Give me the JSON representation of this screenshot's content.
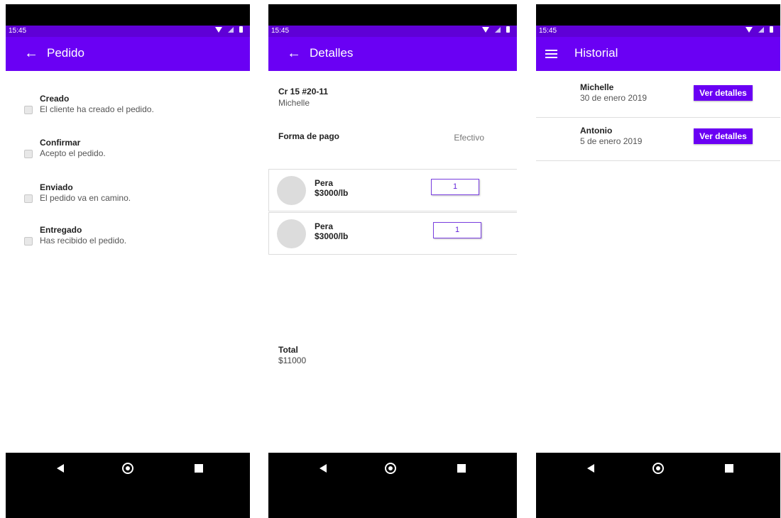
{
  "status_bar": {
    "time": "15:45"
  },
  "colors": {
    "primary": "#6a00f4",
    "status_bar": "#5f00d6",
    "nav_bar": "#000000"
  },
  "pedido": {
    "title": "Pedido",
    "nav_icon": "arrow-back-icon",
    "steps": [
      {
        "label": "Creado",
        "description": "El cliente ha creado el pedido."
      },
      {
        "label": "Confirmar",
        "description": "Acepto el pedido."
      },
      {
        "label": "Enviado",
        "description": "El pedido va en camino."
      },
      {
        "label": "Entregado",
        "description": "Has recibido el pedido."
      }
    ]
  },
  "detalles": {
    "title": "Detalles",
    "nav_icon": "arrow-back-icon",
    "address": "Cr 15 #20-11",
    "customer": "Michelle",
    "payment_label": "Forma de pago",
    "payment_value": "Efectivo",
    "products": [
      {
        "name": "Pera",
        "price": "$3000/lb",
        "quantity": "1"
      },
      {
        "name": "Pera",
        "price": "$3000/lb",
        "quantity": "1"
      }
    ],
    "total_label": "Total",
    "total_value": "$11000"
  },
  "historial": {
    "title": "Historial",
    "nav_icon": "menu-icon",
    "orders": [
      {
        "name": "Michelle",
        "date": "30 de enero 2019",
        "button": "Ver detalles"
      },
      {
        "name": "Antonio",
        "date": "5 de enero 2019",
        "button": "Ver detalles"
      }
    ]
  }
}
